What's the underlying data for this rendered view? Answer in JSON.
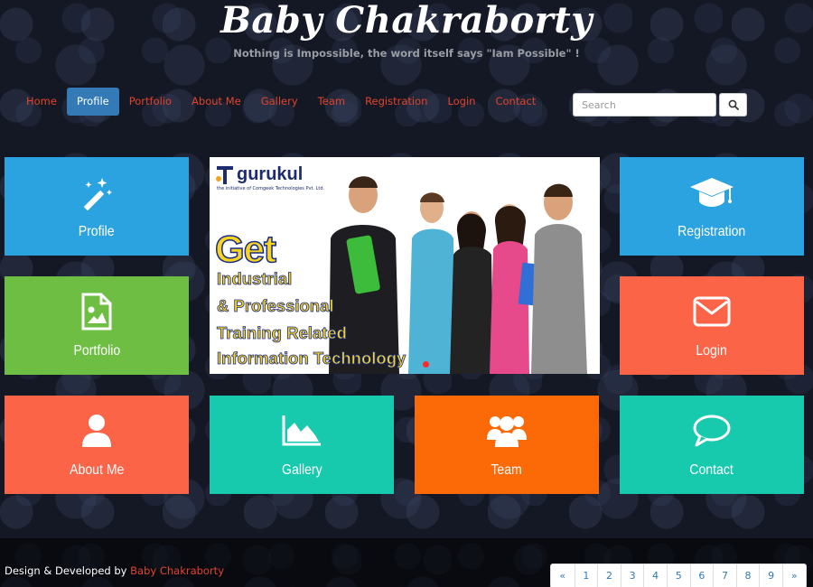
{
  "header": {
    "title": "Baby Chakraborty",
    "tagline": "Nothing is Impossible, the word itself says \"Iam Possible\" !"
  },
  "nav": {
    "items": [
      "Home",
      "Profile",
      "Portfolio",
      "About Me",
      "Gallery",
      "Team",
      "Registration",
      "Login",
      "Contact"
    ],
    "active": "Profile"
  },
  "search": {
    "placeholder": "Search",
    "icon": "search-icon"
  },
  "tiles": {
    "profile": {
      "label": "Profile",
      "icon": "magic-wand-icon",
      "color": "#2aa3e0"
    },
    "portfolio": {
      "label": "Portfolio",
      "icon": "image-file-icon",
      "color": "#6fbe44"
    },
    "about": {
      "label": "About Me",
      "icon": "user-icon",
      "color": "#fb6447"
    },
    "gallery": {
      "label": "Gallery",
      "icon": "area-chart-icon",
      "color": "#17c9ad"
    },
    "team": {
      "label": "Team",
      "icon": "users-icon",
      "color": "#fb6a07"
    },
    "registration": {
      "label": "Registration",
      "icon": "graduation-cap-icon",
      "color": "#2aa3e0"
    },
    "login": {
      "label": "Login",
      "icon": "envelope-icon",
      "color": "#fb6447"
    },
    "contact": {
      "label": "Contact",
      "icon": "speech-bubble-icon",
      "color": "#17c9ad"
    }
  },
  "banner": {
    "logo_text": "gurukul",
    "logo_sub": "the initiative of Comgeek Technologies Pvt. Ltd.",
    "headline": "Get",
    "lines": [
      "Industrial",
      "& Professional",
      "Training Related",
      "Information Technology"
    ]
  },
  "footer": {
    "prefix": "Design & Developed by ",
    "author": "Baby Chakraborty"
  },
  "pagination": {
    "items": [
      "«",
      "1",
      "2",
      "3",
      "4",
      "5",
      "6",
      "7",
      "8",
      "9",
      "»"
    ]
  }
}
